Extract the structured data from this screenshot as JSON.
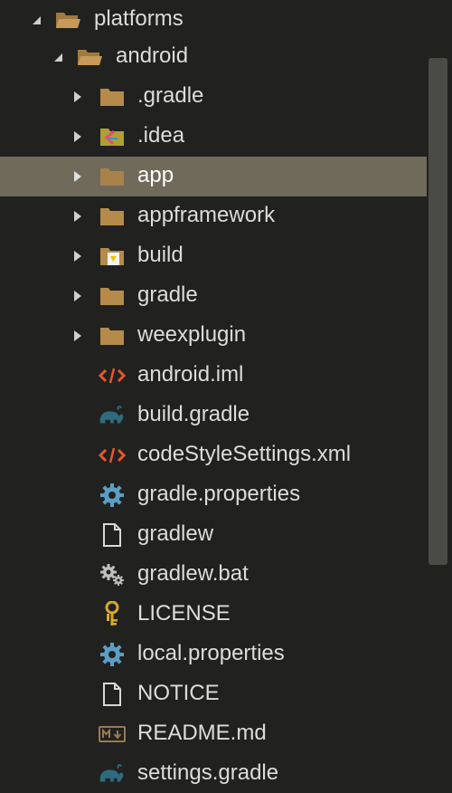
{
  "tree": {
    "items": [
      {
        "label": "platforms",
        "icon": "folder-open-icon",
        "expanded": true,
        "depth": 0
      },
      {
        "label": "android",
        "icon": "folder-open-icon",
        "expanded": true,
        "depth": 1
      },
      {
        "label": ".gradle",
        "icon": "folder-icon",
        "expanded": false,
        "depth": 2
      },
      {
        "label": ".idea",
        "icon": "idea-folder-icon",
        "expanded": false,
        "depth": 2
      },
      {
        "label": "app",
        "icon": "folder-icon",
        "expanded": false,
        "depth": 2,
        "selected": true
      },
      {
        "label": "appframework",
        "icon": "folder-icon",
        "expanded": false,
        "depth": 2
      },
      {
        "label": "build",
        "icon": "build-folder-icon",
        "expanded": false,
        "depth": 2
      },
      {
        "label": "gradle",
        "icon": "folder-icon",
        "expanded": false,
        "depth": 2
      },
      {
        "label": "weexplugin",
        "icon": "folder-icon",
        "expanded": false,
        "depth": 2
      },
      {
        "label": "android.iml",
        "icon": "code-icon",
        "depth": 2
      },
      {
        "label": "build.gradle",
        "icon": "gradle-elephant-icon",
        "depth": 2
      },
      {
        "label": "codeStyleSettings.xml",
        "icon": "code-icon",
        "depth": 2
      },
      {
        "label": "gradle.properties",
        "icon": "gear-icon",
        "depth": 2
      },
      {
        "label": "gradlew",
        "icon": "file-icon",
        "depth": 2
      },
      {
        "label": "gradlew.bat",
        "icon": "gears-icon",
        "depth": 2
      },
      {
        "label": "LICENSE",
        "icon": "key-icon",
        "depth": 2
      },
      {
        "label": "local.properties",
        "icon": "gear-icon",
        "depth": 2
      },
      {
        "label": "NOTICE",
        "icon": "file-icon",
        "depth": 2
      },
      {
        "label": "README.md",
        "icon": "markdown-icon",
        "depth": 2
      },
      {
        "label": "settings.gradle",
        "icon": "gradle-elephant-icon",
        "depth": 2
      }
    ]
  },
  "colors": {
    "background": "#21221f",
    "selection": "#6f6a5a",
    "folder": "#b58a4a",
    "text": "#dcdcdc",
    "code_icon": "#e5572f",
    "gradle_icon": "#2f6b7f",
    "gear_icon": "#5b9ec6",
    "key_icon": "#d9a730"
  }
}
